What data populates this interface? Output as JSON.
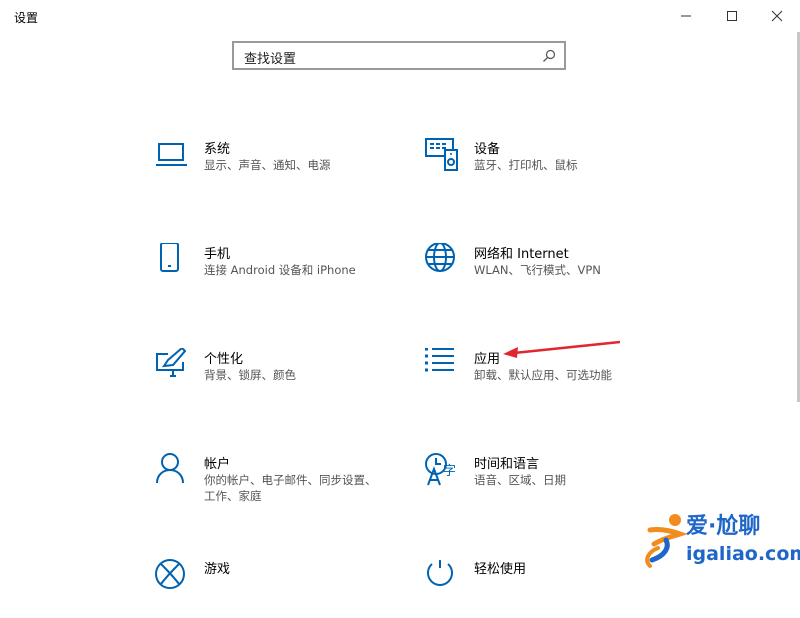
{
  "window": {
    "title": "设置"
  },
  "search": {
    "placeholder": "查找设置"
  },
  "tiles": [
    {
      "name": "系统",
      "desc": "显示、声音、通知、电源",
      "icon": "laptop-icon"
    },
    {
      "name": "设备",
      "desc": "蓝牙、打印机、鼠标",
      "icon": "devices-icon"
    },
    {
      "name": "手机",
      "desc": "连接 Android 设备和 iPhone",
      "icon": "phone-icon"
    },
    {
      "name": "网络和 Internet",
      "desc": "WLAN、飞行模式、VPN",
      "icon": "globe-icon"
    },
    {
      "name": "个性化",
      "desc": "背景、锁屏、颜色",
      "icon": "personalization-icon"
    },
    {
      "name": "应用",
      "desc": "卸载、默认应用、可选功能",
      "icon": "apps-list-icon"
    },
    {
      "name": "帐户",
      "desc": "你的帐户、电子邮件、同步设置、工作、家庭",
      "icon": "person-icon"
    },
    {
      "name": "时间和语言",
      "desc": "语音、区域、日期",
      "icon": "time-language-icon"
    },
    {
      "name": "游戏",
      "desc": "",
      "icon": "xbox-icon"
    },
    {
      "name": "轻松使用",
      "desc": "",
      "icon": "ease-of-access-icon"
    }
  ],
  "watermark": {
    "brand": "爱·尬聊",
    "site": "igaliao.com"
  },
  "colors": {
    "accent": "#0063b1",
    "arrow": "#e0262e"
  }
}
